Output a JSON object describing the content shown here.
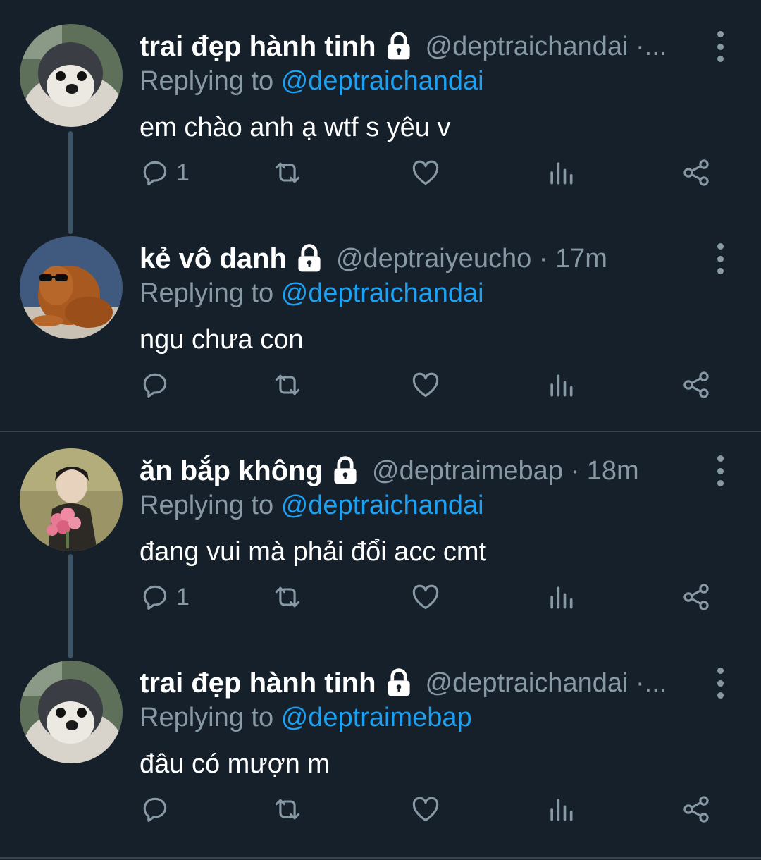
{
  "reply_label": "Replying to",
  "colors": {
    "background": "#15202b",
    "secondary_text": "#8899a6",
    "accent": "#1da1f2",
    "thread_line": "#3d5466"
  },
  "tweets": [
    {
      "name": "trai đẹp hành tinh",
      "handle": "@deptraichandai ·...",
      "reply_to": "@deptraichandai",
      "text": "em chào anh ạ wtf s yêu v",
      "reply_count": "1",
      "avatar": "penguin-avatar"
    },
    {
      "name": "kẻ vô danh",
      "handle": "@deptraiyeucho · 17m",
      "reply_to": "@deptraichandai",
      "text": "ngu chưa con",
      "reply_count": "",
      "avatar": "dog-sunglasses-avatar"
    },
    {
      "name": "ăn bắp không",
      "handle": "@deptraimebap · 18m",
      "reply_to": "@deptraichandai",
      "text": "đang vui mà phải đổi acc cmt",
      "reply_count": "1",
      "avatar": "anime-flowers-avatar"
    },
    {
      "name": "trai đẹp hành tinh",
      "handle": "@deptraichandai ·...",
      "reply_to": "@deptraimebap",
      "text": "đâu có mượn m",
      "reply_count": "",
      "avatar": "penguin-avatar"
    }
  ]
}
